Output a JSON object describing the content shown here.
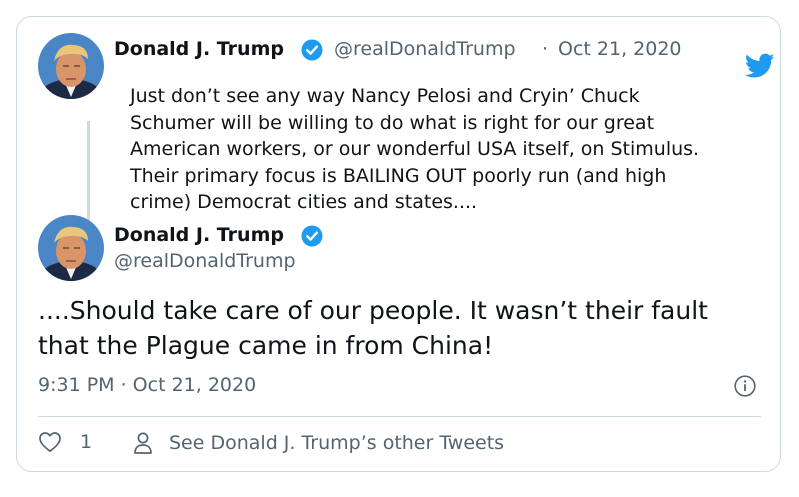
{
  "tweet1": {
    "name": "Donald J. Trump",
    "handle": "@realDonaldTrump",
    "separator": "·",
    "date": "Oct 21, 2020",
    "text": "Just don’t see any way Nancy Pelosi and Cryin’ Chuck\nSchumer will be willing to do what is right for our great\nAmerican workers, or our wonderful USA itself, on Stimulus.\nTheir primary focus is BAILING OUT poorly run (and high\ncrime) Democrat cities and states...."
  },
  "tweet2": {
    "name": "Donald J. Trump",
    "handle": "@realDonaldTrump",
    "text": "....Should take care of our people. It wasn’t their fault\nthat the Plague came in from China!",
    "timestamp": "9:31 PM · Oct 21, 2020"
  },
  "actions": {
    "like_count": "1",
    "other_tweets_label": "See Donald J. Trump’s other Tweets"
  },
  "icons": {
    "verified": "verified-badge-icon",
    "bird": "twitter-bird-icon",
    "info": "info-icon",
    "heart": "heart-icon",
    "person": "person-icon"
  },
  "colors": {
    "verified": "#1d9bf0",
    "brand": "#1d9bf0",
    "secondary_text": "#536471",
    "border": "#cfd9de"
  }
}
